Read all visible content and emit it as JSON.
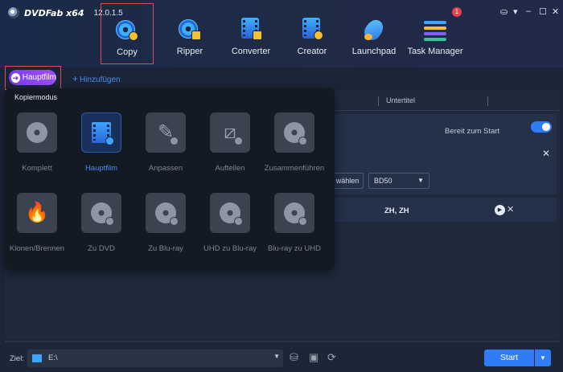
{
  "app": {
    "name": "DVDFab x64",
    "version": "12.0.1.5",
    "notification_count": "1"
  },
  "nav": {
    "items": [
      {
        "label": "Copy",
        "icon": "copy-disc-icon"
      },
      {
        "label": "Ripper",
        "icon": "ripper-icon"
      },
      {
        "label": "Converter",
        "icon": "converter-icon"
      },
      {
        "label": "Creator",
        "icon": "creator-icon"
      },
      {
        "label": "Launchpad",
        "icon": "rocket-icon"
      },
      {
        "label": "Task Manager",
        "icon": "task-manager-icon"
      }
    ],
    "active": "Copy"
  },
  "toolbar": {
    "mode_label": "Hauptfilm",
    "add_label": "Hinzufügen"
  },
  "mode_panel": {
    "title": "Kopiermodus",
    "modes": [
      {
        "label": "Komplett",
        "icon": "disc-icon",
        "active": false
      },
      {
        "label": "Hauptfilm",
        "icon": "film-icon",
        "active": true
      },
      {
        "label": "Anpassen",
        "icon": "edit-icon",
        "active": false
      },
      {
        "label": "Aufteilen",
        "icon": "split-icon",
        "active": false
      },
      {
        "label": "Zusammenführen",
        "icon": "merge-icon",
        "active": false
      },
      {
        "label": "Klonen/Brennen",
        "icon": "burn-icon",
        "active": false
      },
      {
        "label": "Zu DVD",
        "icon": "dvd-icon",
        "active": false
      },
      {
        "label": "Zu Blu-ray",
        "icon": "bluray-icon",
        "active": false
      },
      {
        "label": "UHD zu Blu-ray",
        "icon": "uhd-to-bluray-icon",
        "active": false
      },
      {
        "label": "Blu-ray zu UHD",
        "icon": "bluray-to-uhd-icon",
        "active": false
      }
    ]
  },
  "content": {
    "column_untertitel": "Untertitel",
    "status": "Bereit zum Start",
    "choose_button": "wählen",
    "output_format": "BD50",
    "subtitle_langs": "ZH, ZH"
  },
  "footer": {
    "target_label": "Ziel:",
    "target_path": "E:\\",
    "start_label": "Start"
  },
  "colors": {
    "accent_blue": "#2f7cf6",
    "mode_pill": "#8a45f3",
    "highlight_red": "#e34a55"
  }
}
